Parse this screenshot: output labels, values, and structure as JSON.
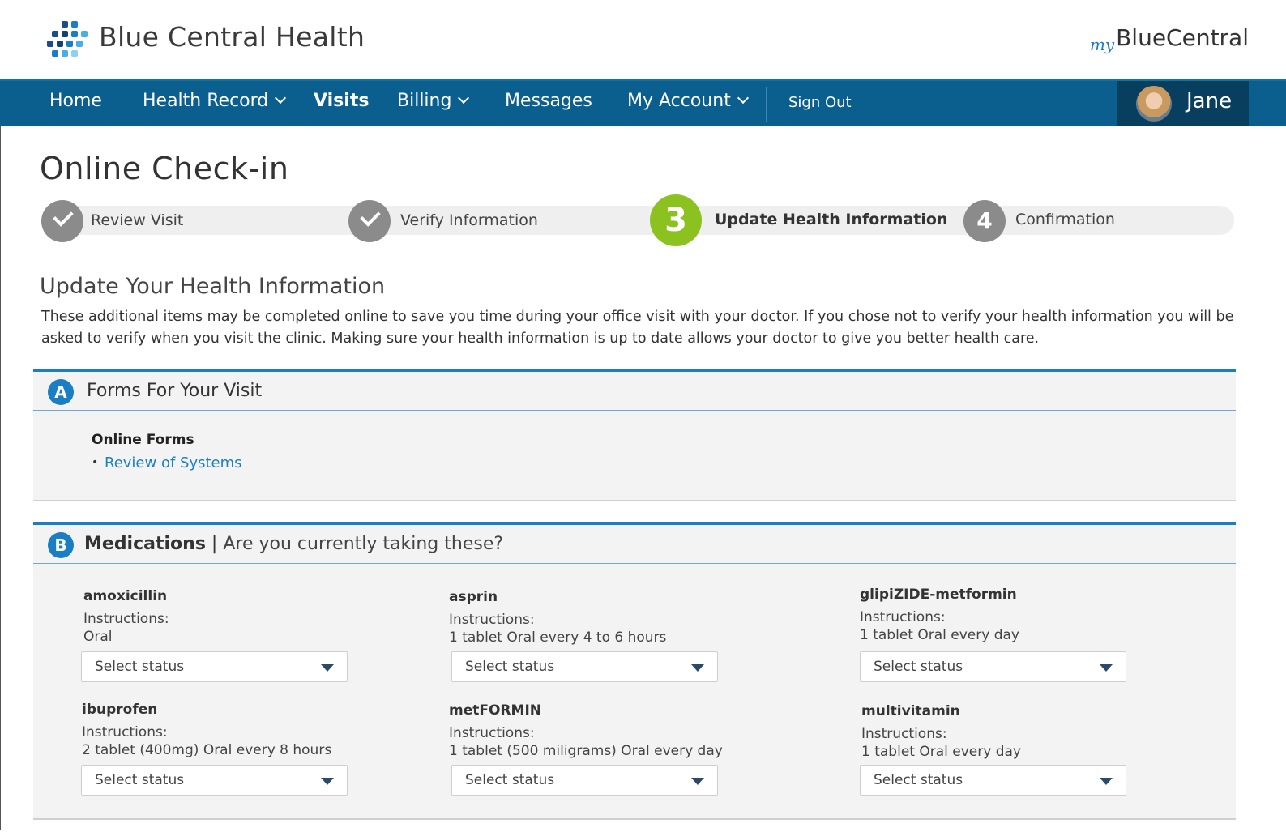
{
  "header": {
    "brand": "Blue Central Health",
    "my_brand_prefix": "my",
    "my_brand_name": "BlueCentral"
  },
  "nav": {
    "items": [
      {
        "label": "Home"
      },
      {
        "label": "Health Record"
      },
      {
        "label": "Visits"
      },
      {
        "label": "Billing"
      },
      {
        "label": "Messages"
      },
      {
        "label": "My Account"
      },
      {
        "label": "Sign Out"
      }
    ],
    "active": "Visits",
    "user_name": "Jane"
  },
  "page": {
    "title": "Online Check-in"
  },
  "stepper": {
    "steps": [
      {
        "label": "Review Visit",
        "status": "complete"
      },
      {
        "label": "Verify Information",
        "status": "complete"
      },
      {
        "label": "Update Health Information",
        "status": "current",
        "number": "3"
      },
      {
        "label": "Confirmation",
        "status": "upcoming",
        "number": "4"
      }
    ],
    "current_color": "#8cc21f"
  },
  "main": {
    "heading": "Update Your Health Information",
    "intro": "These additional items may be completed online to save you time during your office visit with your doctor. If you chose not to verify your health information you will be asked to verify when you visit the clinic. Making sure your health information is up to date allows your doctor to give you better health care."
  },
  "forms_section": {
    "badge": "A",
    "title": "Forms For Your Visit",
    "subheading": "Online Forms",
    "bullet": "•",
    "links": [
      "Review of Systems"
    ]
  },
  "medications_section": {
    "badge": "B",
    "title": "Medications",
    "separator": "|",
    "subtitle": "Are you currently taking these?",
    "instructions_label": "Instructions:",
    "select_placeholder": "Select status",
    "items": [
      {
        "name": "amoxicillin",
        "instructions": "Oral"
      },
      {
        "name": "asprin",
        "instructions": "1 tablet Oral every 4 to 6 hours"
      },
      {
        "name": "glipiZIDE-metformin",
        "instructions": "1 tablet Oral every day"
      },
      {
        "name": "ibuprofen",
        "instructions": "2 tablet (400mg) Oral every 8 hours"
      },
      {
        "name": "metFORMIN",
        "instructions": "1 tablet (500 miligrams) Oral every day"
      },
      {
        "name": "multivitamin",
        "instructions": "1 tablet Oral every day"
      }
    ]
  },
  "colors": {
    "nav_bg": "#0a5f8f",
    "accent": "#1a7ec4",
    "user_box": "#083f5f"
  }
}
